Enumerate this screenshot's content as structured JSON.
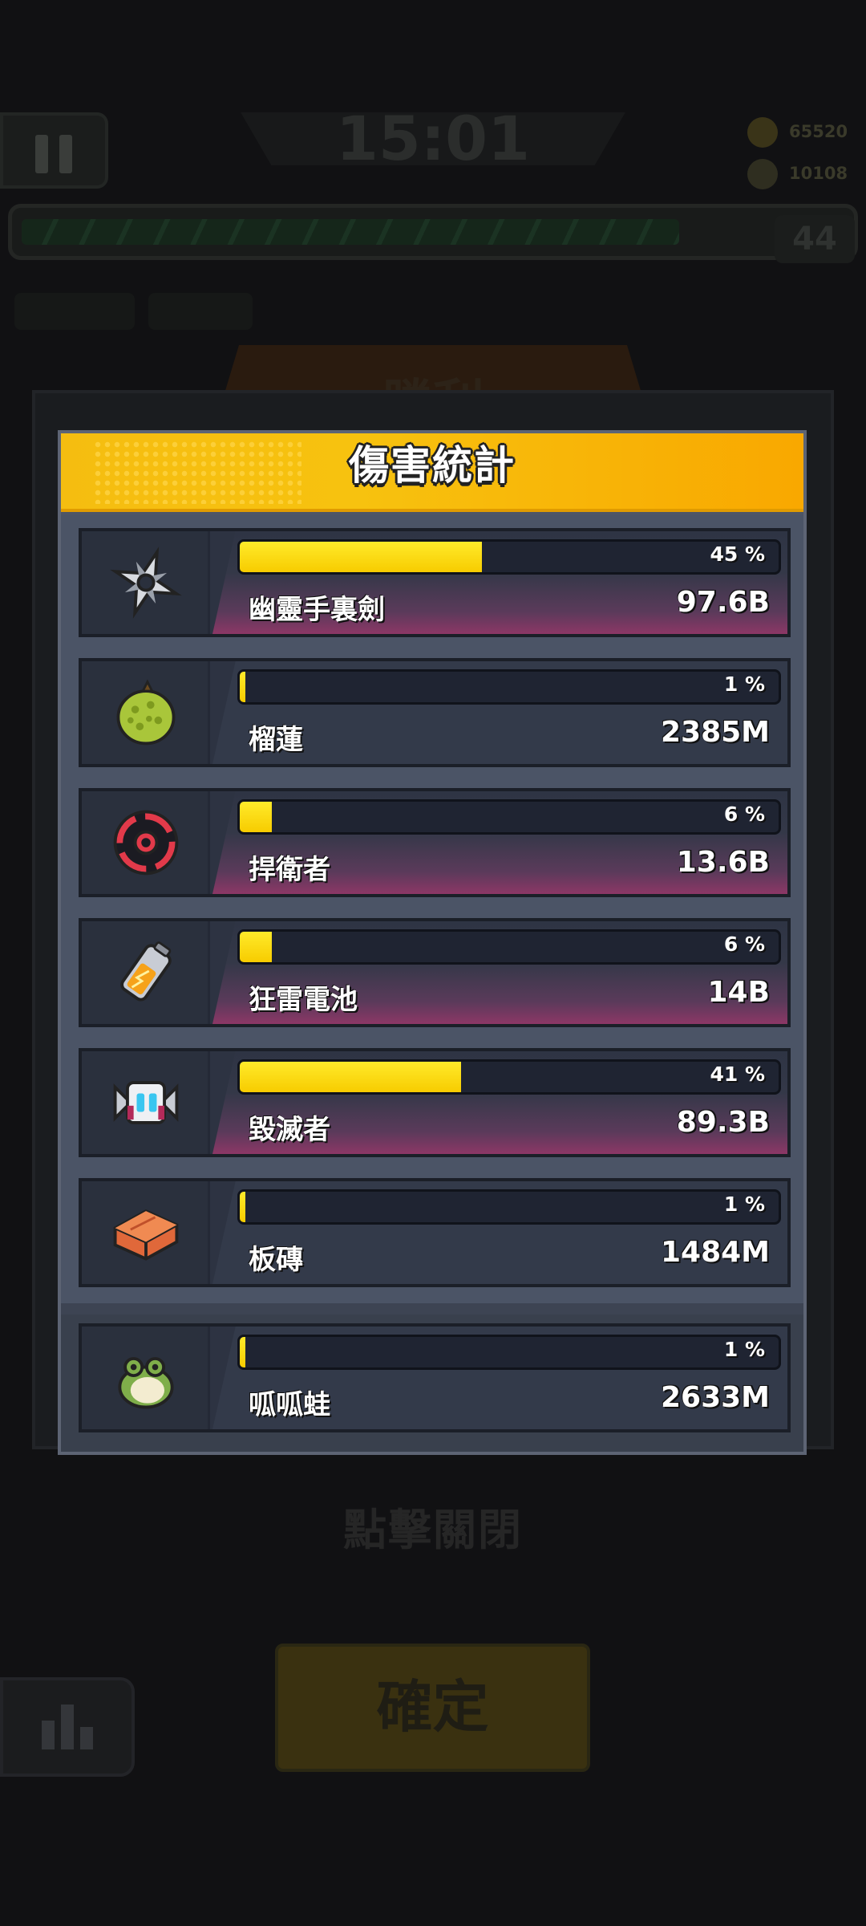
{
  "hud": {
    "timer": "15:01",
    "coins": "65520",
    "gems": "10108",
    "level": "44",
    "victory_title": "勝利",
    "tap_to_close": "點擊關閉",
    "confirm_label": "確定"
  },
  "dialog": {
    "title": "傷害統計"
  },
  "skills": [
    {
      "name": "幽靈手裏劍",
      "percent_label": "45 %",
      "percent": 45,
      "damage": "97.6B",
      "icon": "ghost-shuriken-icon",
      "highlight": true
    },
    {
      "name": "榴蓮",
      "percent_label": "1 %",
      "percent": 1,
      "damage": "2385M",
      "icon": "durian-icon",
      "highlight": false
    },
    {
      "name": "捍衛者",
      "percent_label": "6 %",
      "percent": 6,
      "damage": "13.6B",
      "icon": "defender-ring-icon",
      "highlight": true
    },
    {
      "name": "狂雷電池",
      "percent_label": "6 %",
      "percent": 6,
      "damage": "14B",
      "icon": "thunder-battery-icon",
      "highlight": true
    },
    {
      "name": "毀滅者",
      "percent_label": "41 %",
      "percent": 41,
      "damage": "89.3B",
      "icon": "destroyer-drone-icon",
      "highlight": true
    },
    {
      "name": "板磚",
      "percent_label": "1 %",
      "percent": 1,
      "damage": "1484M",
      "icon": "brick-icon",
      "highlight": false
    }
  ],
  "pet": {
    "name": "呱呱蛙",
    "percent_label": "1 %",
    "percent": 1,
    "damage": "2633M",
    "icon": "frog-pet-icon",
    "highlight": false
  },
  "colors": {
    "accent": "#f7c20f",
    "bar_fill": "#ffe21a",
    "panel": "#4b5466"
  }
}
